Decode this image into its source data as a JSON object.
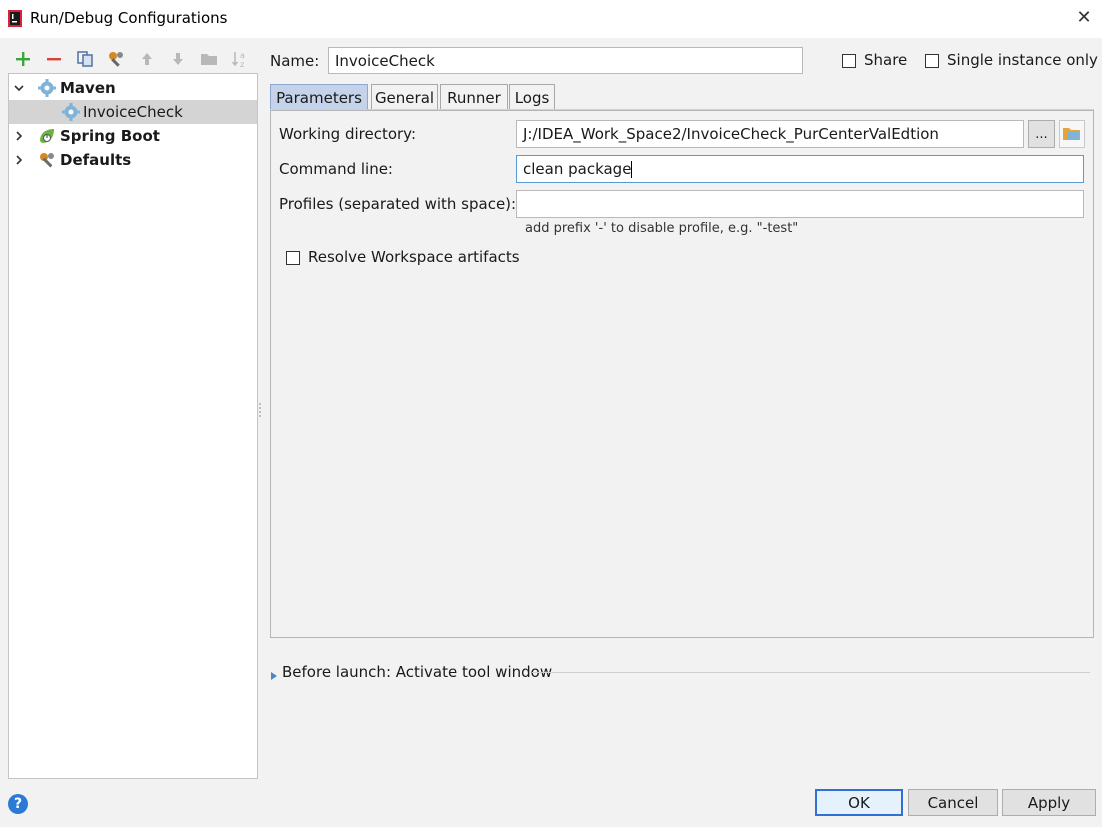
{
  "window": {
    "title": "Run/Debug Configurations"
  },
  "toolbar": {
    "buttons": [
      "add-icon",
      "remove-icon",
      "copy-icon",
      "edit-defaults-icon",
      "move-up-icon",
      "move-down-icon",
      "folder-icon",
      "sort-icon"
    ]
  },
  "tree": {
    "items": [
      {
        "label": "Maven",
        "expanded": true,
        "icon": "gear-icon"
      },
      {
        "label": "InvoiceCheck",
        "selected": true,
        "icon": "gear-icon"
      },
      {
        "label": "Spring Boot",
        "expanded": false,
        "icon": "spring-boot-icon"
      },
      {
        "label": "Defaults",
        "expanded": false,
        "icon": "wrench-icon"
      }
    ]
  },
  "name_row": {
    "label": "Name:",
    "value": "InvoiceCheck",
    "share_label": "Share",
    "share_checked": false,
    "single_instance_label": "Single instance only",
    "single_instance_checked": false
  },
  "tabs": [
    {
      "label": "Parameters",
      "active": true
    },
    {
      "label": "General"
    },
    {
      "label": "Runner"
    },
    {
      "label": "Logs"
    }
  ],
  "parameters": {
    "working_dir_label": "Working directory:",
    "working_dir_value": "J:/IDEA_Work_Space2/InvoiceCheck_PurCenterValEdtion",
    "browse_label": "...",
    "command_line_label": "Command line:",
    "command_line_value": "clean package",
    "profiles_label": "Profiles (separated with space):",
    "profiles_value": "",
    "profiles_hint": "add prefix '-' to disable profile, e.g. \"-test\"",
    "resolve_label": "Resolve Workspace artifacts",
    "resolve_checked": false
  },
  "before_launch": {
    "label": "Before launch: Activate tool window"
  },
  "footer": {
    "ok_label": "OK",
    "cancel_label": "Cancel",
    "apply_label": "Apply"
  },
  "colors": {
    "accent": "#2f6fd6",
    "tab_active": "#c4d3ea",
    "add_green": "#3aa63a",
    "remove_red": "#d9423a"
  }
}
